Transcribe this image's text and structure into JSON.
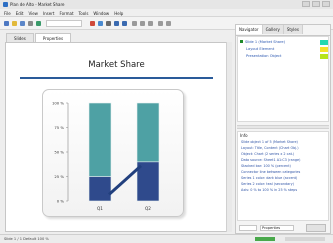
{
  "window": {
    "title": "Plan de Alto - Market Share"
  },
  "menu": [
    "File",
    "Edit",
    "View",
    "Insert",
    "Format",
    "Tools",
    "Window",
    "Help"
  ],
  "document_tabs": [
    "Slides",
    "Properties"
  ],
  "slide": {
    "title": "Market Share"
  },
  "chart_data": {
    "type": "bar",
    "categories": [
      "Q1",
      "Q2"
    ],
    "series": [
      {
        "values": [
          25,
          40
        ]
      },
      {
        "values": [
          75,
          60
        ]
      }
    ],
    "ylim": [
      0,
      100
    ],
    "yticks": [
      "0 %",
      "25 %",
      "50 %",
      "75 %",
      "100 %"
    ],
    "stacked": true,
    "grid": false,
    "colors": {
      "bottom": "#2f4a8c",
      "top": "#4ea1a4",
      "connector": "#22407e"
    }
  },
  "panel": {
    "tabs": [
      "Navigator",
      "Gallery",
      "Styles"
    ],
    "layers": [
      {
        "label": "Slide 1 (Market Share)",
        "color": "#24d8b0"
      },
      {
        "label": "Layout Element",
        "color": "#f5e22a"
      },
      {
        "label": "Presentation Object",
        "color": "#b7e41c"
      }
    ],
    "info_header": "Info",
    "info_lines": [
      "Slide object 1 of 5 (Market Share)",
      "Layout: Title, Content (Chart Obj.)",
      "Object: Chart (2 series x 2 cat.)",
      "Data source: Sheet1 A1:C3 (range)",
      "Stacked bar: 100 % (percent)",
      "Connector line between categories",
      "Series 1 color: dark blue (accent)",
      "Series 2 color: teal (secondary)",
      "Axis: 0 % to 100 % in 25 % steps"
    ],
    "footer_select": "Properties"
  },
  "status": {
    "text": "Slide 1 / 1  Default  100 %"
  }
}
